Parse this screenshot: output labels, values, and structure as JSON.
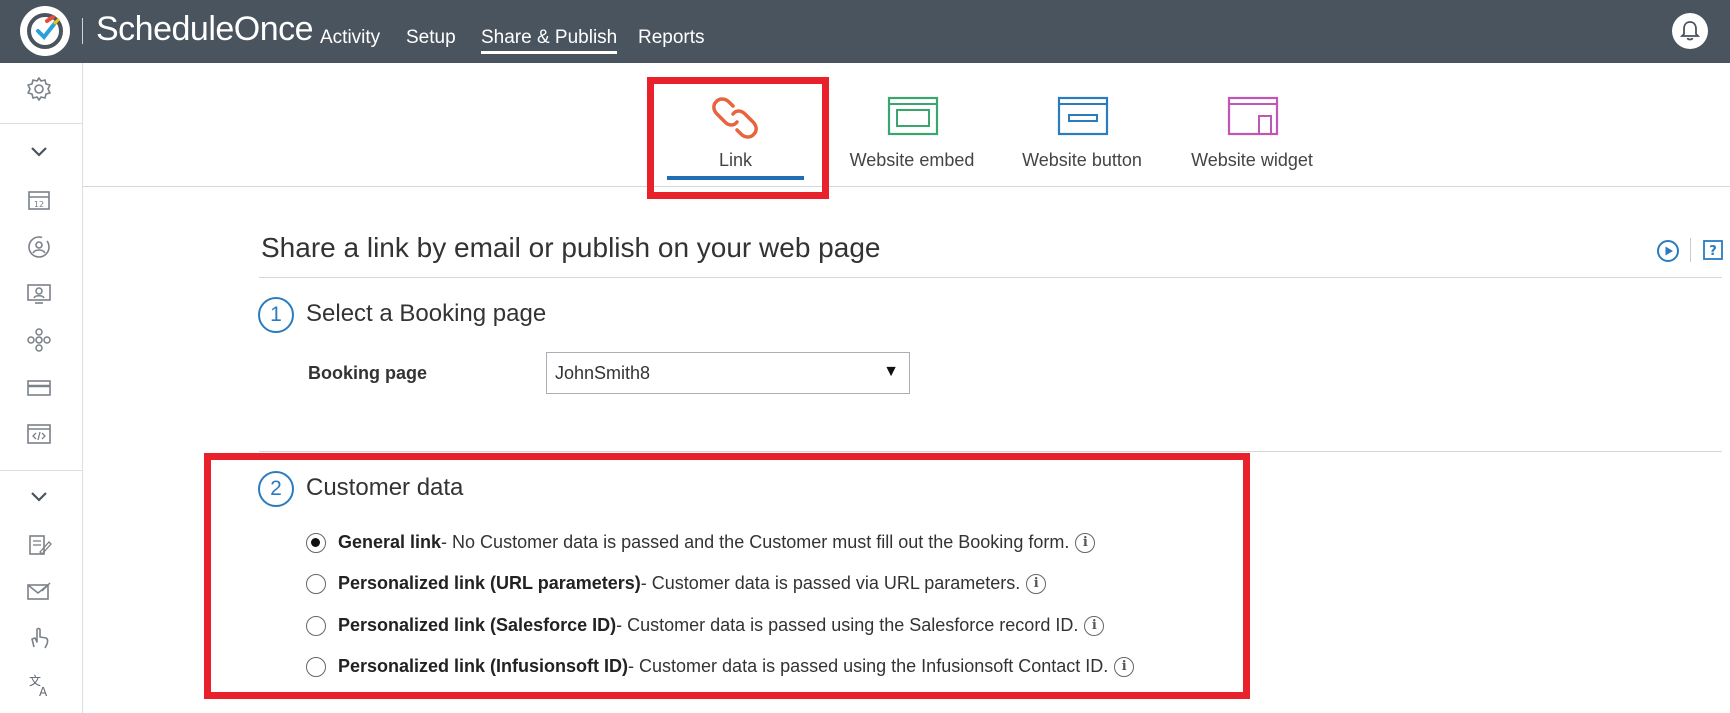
{
  "brand": {
    "name": "ScheduleOnce"
  },
  "nav": {
    "items": [
      {
        "label": "Activity"
      },
      {
        "label": "Setup"
      },
      {
        "label": "Share & Publish"
      },
      {
        "label": "Reports"
      }
    ],
    "active": "Share & Publish"
  },
  "tabs": [
    {
      "label": "Link",
      "icon": "link-icon",
      "color": "#e8643c"
    },
    {
      "label": "Website embed",
      "icon": "website-embed-icon",
      "color": "#3aa66e"
    },
    {
      "label": "Website button",
      "icon": "website-button-icon",
      "color": "#2b7bbf"
    },
    {
      "label": "Website widget",
      "icon": "website-widget-icon",
      "color": "#c256b5"
    }
  ],
  "active_tab": "Link",
  "page": {
    "title": "Share a link by email or publish on your web page"
  },
  "step1": {
    "number": "1",
    "title": "Select a Booking page",
    "field_label": "Booking page",
    "selected_value": "JohnSmith8"
  },
  "step2": {
    "number": "2",
    "title": "Customer data",
    "options": [
      {
        "label": "General link",
        "description": " - No Customer data is passed and the Customer must fill out the Booking form.",
        "checked": true
      },
      {
        "label": "Personalized link (URL parameters)",
        "description": " - Customer data is passed via URL parameters.",
        "checked": false
      },
      {
        "label": "Personalized link (Salesforce ID)",
        "description": " - Customer data is passed using the Salesforce record ID.",
        "checked": false
      },
      {
        "label": "Personalized link (Infusionsoft ID)",
        "description": " - Customer data is passed using the Infusionsoft Contact ID.",
        "checked": false
      }
    ]
  },
  "colors": {
    "topbar": "#4a545e",
    "accent": "#2b7bbf",
    "highlight": "#e8212b",
    "tab_underline": "#1f6fb2"
  }
}
